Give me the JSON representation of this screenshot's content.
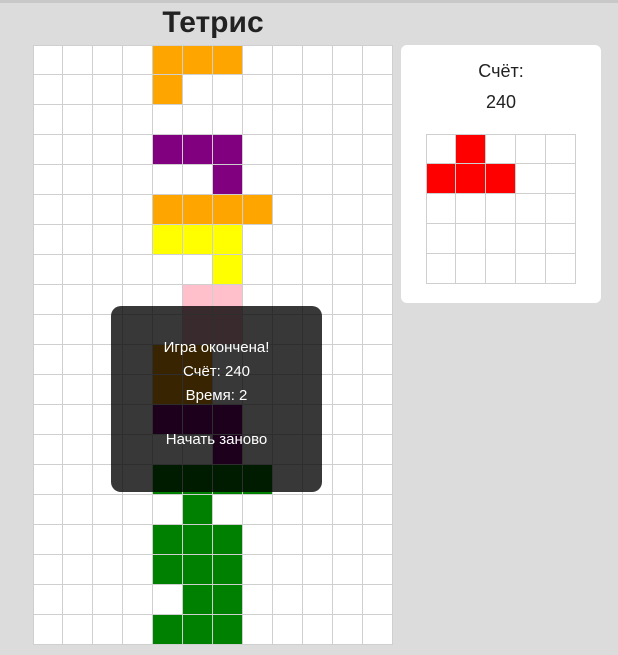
{
  "app": {
    "title": "Тетрис"
  },
  "board": {
    "cols": 12,
    "rows": 20,
    "grid_color": "#cfcfcf",
    "filled": [
      {
        "r": 0,
        "c": 4,
        "color": "#FFA500"
      },
      {
        "r": 0,
        "c": 5,
        "color": "#FFA500"
      },
      {
        "r": 0,
        "c": 6,
        "color": "#FFA500"
      },
      {
        "r": 1,
        "c": 4,
        "color": "#FFA500"
      },
      {
        "r": 3,
        "c": 4,
        "color": "#800080"
      },
      {
        "r": 3,
        "c": 5,
        "color": "#800080"
      },
      {
        "r": 3,
        "c": 6,
        "color": "#800080"
      },
      {
        "r": 4,
        "c": 6,
        "color": "#800080"
      },
      {
        "r": 5,
        "c": 4,
        "color": "#FFA500"
      },
      {
        "r": 5,
        "c": 5,
        "color": "#FFA500"
      },
      {
        "r": 5,
        "c": 6,
        "color": "#FFA500"
      },
      {
        "r": 5,
        "c": 7,
        "color": "#FFA500"
      },
      {
        "r": 6,
        "c": 4,
        "color": "#FFFF00"
      },
      {
        "r": 6,
        "c": 5,
        "color": "#FFFF00"
      },
      {
        "r": 6,
        "c": 6,
        "color": "#FFFF00"
      },
      {
        "r": 7,
        "c": 6,
        "color": "#FFFF00"
      },
      {
        "r": 8,
        "c": 5,
        "color": "#FFC0CB"
      },
      {
        "r": 8,
        "c": 6,
        "color": "#FFC0CB"
      },
      {
        "r": 9,
        "c": 5,
        "color": "#FFC0CB"
      },
      {
        "r": 9,
        "c": 6,
        "color": "#FFC0CB"
      },
      {
        "r": 10,
        "c": 4,
        "color": "#FFA500"
      },
      {
        "r": 10,
        "c": 5,
        "color": "#FFA500"
      },
      {
        "r": 11,
        "c": 4,
        "color": "#FFA500"
      },
      {
        "r": 11,
        "c": 5,
        "color": "#FFA500"
      },
      {
        "r": 12,
        "c": 4,
        "color": "#800080"
      },
      {
        "r": 12,
        "c": 5,
        "color": "#800080"
      },
      {
        "r": 12,
        "c": 6,
        "color": "#800080"
      },
      {
        "r": 13,
        "c": 6,
        "color": "#800080"
      },
      {
        "r": 14,
        "c": 4,
        "color": "#008000"
      },
      {
        "r": 14,
        "c": 5,
        "color": "#008000"
      },
      {
        "r": 14,
        "c": 6,
        "color": "#008000"
      },
      {
        "r": 14,
        "c": 7,
        "color": "#008000"
      },
      {
        "r": 15,
        "c": 5,
        "color": "#008000"
      },
      {
        "r": 16,
        "c": 4,
        "color": "#008000"
      },
      {
        "r": 16,
        "c": 5,
        "color": "#008000"
      },
      {
        "r": 16,
        "c": 6,
        "color": "#008000"
      },
      {
        "r": 17,
        "c": 4,
        "color": "#008000"
      },
      {
        "r": 17,
        "c": 5,
        "color": "#008000"
      },
      {
        "r": 17,
        "c": 6,
        "color": "#008000"
      },
      {
        "r": 18,
        "c": 5,
        "color": "#008000"
      },
      {
        "r": 18,
        "c": 6,
        "color": "#008000"
      },
      {
        "r": 19,
        "c": 4,
        "color": "#008000"
      },
      {
        "r": 19,
        "c": 5,
        "color": "#008000"
      },
      {
        "r": 19,
        "c": 6,
        "color": "#008000"
      }
    ]
  },
  "sidebar": {
    "score_label": "Счёт:",
    "score_value": "240",
    "next_piece": {
      "cols": 5,
      "rows": 5,
      "filled": [
        {
          "r": 0,
          "c": 1,
          "color": "#FF0000"
        },
        {
          "r": 1,
          "c": 0,
          "color": "#FF0000"
        },
        {
          "r": 1,
          "c": 1,
          "color": "#FF0000"
        },
        {
          "r": 1,
          "c": 2,
          "color": "#FF0000"
        }
      ]
    }
  },
  "game_over": {
    "title": "Игра окончена!",
    "score": "Счёт: 240",
    "time": "Время: 2",
    "restart_label": "Начать заново"
  }
}
